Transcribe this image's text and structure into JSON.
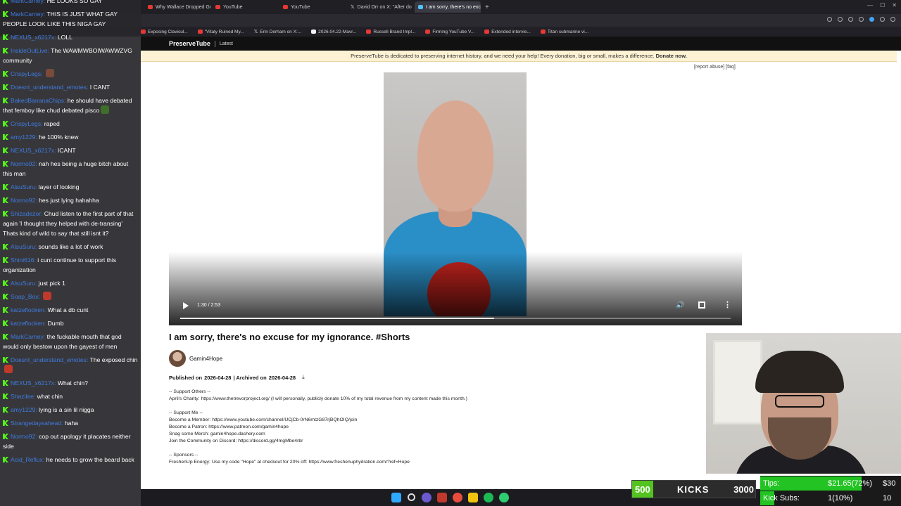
{
  "browser": {
    "tabs": [
      {
        "label": "Why Wallace Dropped Gr",
        "icon": "youtube-icon",
        "active": false
      },
      {
        "label": "YouTube",
        "icon": "youtube-icon",
        "active": false
      },
      {
        "label": "YouTube",
        "icon": "youtube-icon",
        "active": false
      },
      {
        "label": "David Orr on X: \"After do",
        "icon": "x-icon",
        "active": false
      },
      {
        "label": "I am sorry, there's no exc",
        "icon": "preservetube-icon",
        "active": true
      }
    ],
    "new_tab": "+",
    "bookmarks": [
      {
        "label": "Exposing Clavicul...",
        "icon": "youtube-icon"
      },
      {
        "label": "\"Vitaly Ruined My...",
        "icon": "youtube-icon"
      },
      {
        "label": "Erin Derham on X:...",
        "icon": "x-icon"
      },
      {
        "label": "2026.04.22-Mavr...",
        "icon": "calendar-icon"
      },
      {
        "label": "Russell Brand Impl...",
        "icon": "youtube-icon"
      },
      {
        "label": "Firming YouTube V...",
        "icon": "youtube-icon"
      },
      {
        "label": "Extended intervie...",
        "icon": "youtube-icon"
      },
      {
        "label": "Titan submarine vi...",
        "icon": "youtube-icon"
      }
    ]
  },
  "site": {
    "logo": "PreserveTube",
    "nav_latest": "Latest",
    "banner_text": "PreserveTube is dedicated to preserving internet history, and we need your help! Every donation, big or small, makes a difference.",
    "banner_link": "Donate now.",
    "report_links": "[report abuse] [faq]"
  },
  "video": {
    "current_time": "1:30",
    "duration": "2:53",
    "timecode": "1:30 / 2:53",
    "progress": 0.57,
    "title": "I am sorry, there's no excuse for my ignorance. #Shorts",
    "channel": "Gamin4Hope",
    "published_label": "Published on",
    "published_date": "2026-04-28",
    "archived_label": "| Archived on",
    "archived_date": "2026-04-28",
    "description": "-- Support Others --\nApril's Charity: https://www.thetrevorproject.org/ (I will personally, publicly donate 10% of my total revenue from my content made this month.)\n\n-- Support Me --\nBecome a Member: https://www.youtube.com/channel/UCjCb-0rN6mtzG87rjBQhOIQ/join\nBecome a Patron: https://www.patreon.com/gamin4hope\nSnag some Merch: gamin4hope.dashery.com\nJoin the Community on Discord: https://discord.gg/4mgMbe4rbr\n\n-- Sponsors --\nFreshenUp Energy: Use my code \"Hope\" at checkout for 20% off: https://www.freshenuphydration.com/?ref=Hope"
  },
  "chat": {
    "messages": [
      {
        "user": "MarkCarney:",
        "text": "HE LOOKS SO GAY"
      },
      {
        "user": "MarkCarney:",
        "text": "THIS IS JUST WHAT GAY PEOPLE LOOK LIKE THIS NIGA GAY"
      },
      {
        "user": "NEXUS_x6217x:",
        "text": "LOLL"
      },
      {
        "user": "InsideOutLive:",
        "text": "The WAWMWBOIWAWWZVG community"
      },
      {
        "user": "CrispyLegs:",
        "text": "",
        "emote": "e1"
      },
      {
        "user": "Doesnt_understand_emotes:",
        "text": "I CANT"
      },
      {
        "user": "BakedBananaChips:",
        "text": "he should have debated that femboy like chud debated pisco",
        "emote": "e2"
      },
      {
        "user": "CrispyLegs:",
        "text": "raped"
      },
      {
        "user": "amy1229:",
        "text": "he 100% knew"
      },
      {
        "user": "NEXUS_x6217x:",
        "text": "ICANT"
      },
      {
        "user": "Normo92:",
        "text": "nah hes being a huge bitch about this man"
      },
      {
        "user": "AlsuSuru:",
        "text": "layer of looking"
      },
      {
        "user": "Normo92:",
        "text": "hes just lying hahahha"
      },
      {
        "user": "Shizadezor:",
        "text": "Chud listen to the first part of that again 'I thought they helped with de-transing' Thats kind of wild to say that still isnt it?"
      },
      {
        "user": "AlsuSuru:",
        "text": "sounds like a lot of work"
      },
      {
        "user": "Shini616:",
        "text": "i cunt continue to support this organization"
      },
      {
        "user": "AlsuSuru:",
        "text": "just pick 1"
      },
      {
        "user": "Soap_Box:",
        "text": "",
        "emote": "e3"
      },
      {
        "user": "katzeflocken:",
        "text": "What a db cunt"
      },
      {
        "user": "katzeflocken:",
        "text": "Dumb"
      },
      {
        "user": "MarkCarney:",
        "text": "the fuckable mouth that god would only bestow upon the gayest of men"
      },
      {
        "user": "Doesnt_understand_emotes:",
        "text": "The exposed chin",
        "emote": "e3"
      },
      {
        "user": "NEXUS_x6217x:",
        "text": "What chin?"
      },
      {
        "user": "Shazilee:",
        "text": "what chin"
      },
      {
        "user": "amy1229:",
        "text": "lying is a sin lil nigga"
      },
      {
        "user": "Strangedaysahead:",
        "text": "haha"
      },
      {
        "user": "Normo92:",
        "text": "cop out apology it placates neither side"
      },
      {
        "user": "Acid_Reflux:",
        "text": "he needs to grow the beard back"
      }
    ]
  },
  "widgets": {
    "kicks": {
      "current": "500",
      "label": "KICKS",
      "goal": "3000",
      "progress": 0.17
    },
    "tips": {
      "label": "Tips:",
      "value": "$21.65(72%)",
      "goal": "$30",
      "progress": 0.72
    },
    "kick_subs": {
      "label": "Kick Subs:",
      "value": "1(10%)",
      "goal": "10",
      "progress": 0.1
    }
  },
  "colors": {
    "kick_green": "#53fc18",
    "chat_user": "#3f7be0",
    "banner_bg": "#fdf2d4"
  }
}
